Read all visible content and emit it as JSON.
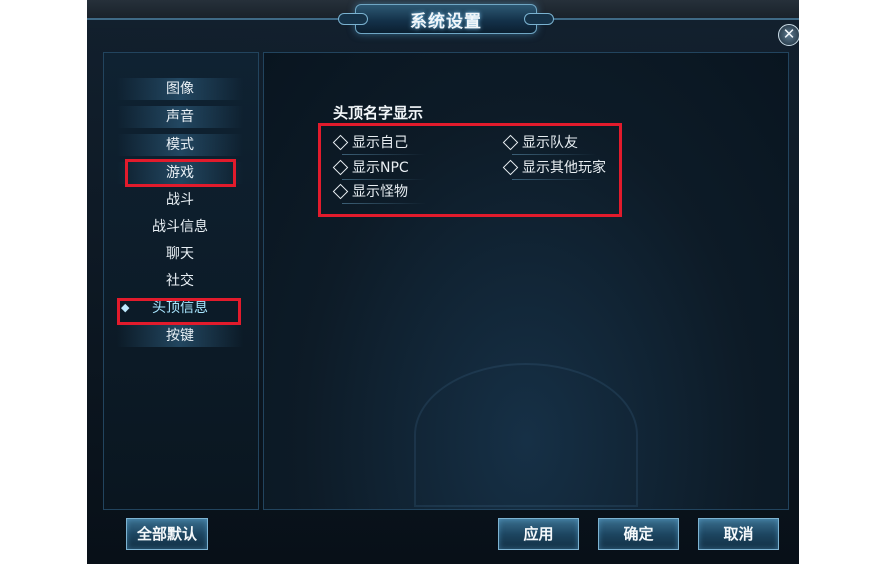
{
  "window": {
    "title": "系统设置"
  },
  "close_glyph": "✕",
  "sidebar": {
    "items": [
      {
        "label": "图像"
      },
      {
        "label": "声音"
      },
      {
        "label": "模式"
      },
      {
        "label": "游戏"
      },
      {
        "label": "战斗"
      },
      {
        "label": "战斗信息"
      },
      {
        "label": "聊天"
      },
      {
        "label": "社交"
      },
      {
        "label": "头顶信息"
      },
      {
        "label": "按键"
      }
    ],
    "active_marker": "◆"
  },
  "content": {
    "section_title": "头顶名字显示",
    "options": [
      {
        "label": "显示自己"
      },
      {
        "label": "显示队友"
      },
      {
        "label": "显示NPC"
      },
      {
        "label": "显示其他玩家"
      },
      {
        "label": "显示怪物"
      }
    ]
  },
  "buttons": {
    "reset_all": "全部默认",
    "apply": "应用",
    "ok": "确定",
    "cancel": "取消"
  },
  "colors": {
    "highlight": "#e21b2c",
    "accent": "#7db3d2"
  }
}
